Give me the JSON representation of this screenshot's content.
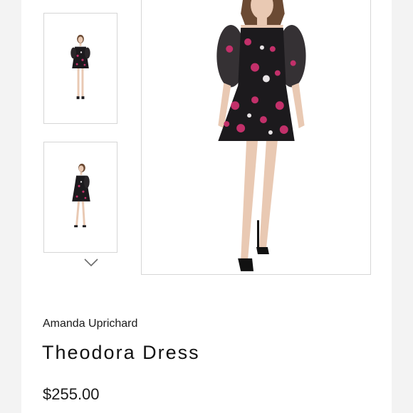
{
  "product": {
    "brand": "Amanda Uprichard",
    "name": "Theodora Dress",
    "price": "$255.00"
  },
  "gallery": {
    "thumbnails": [
      {
        "view": "front"
      },
      {
        "view": "side"
      }
    ],
    "scroll_icon": "chevron-down-icon"
  },
  "colors": {
    "dress": "#1c1a1d",
    "flower_pink": "#c2306a",
    "flower_white": "#e8e4e6",
    "skin": "#e9c9b3",
    "hair": "#6b4a33",
    "border": "#d6d6d6"
  }
}
